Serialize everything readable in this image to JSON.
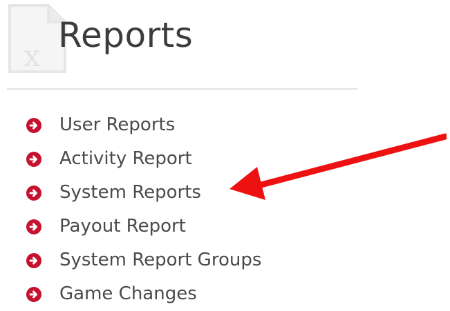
{
  "header": {
    "title": "Reports",
    "icon": "excel-document-icon"
  },
  "reports": {
    "items": [
      {
        "label": "User Reports",
        "icon": "circle-arrow-right-icon"
      },
      {
        "label": "Activity Report",
        "icon": "circle-arrow-right-icon"
      },
      {
        "label": "System Reports",
        "icon": "circle-arrow-right-icon"
      },
      {
        "label": "Payout Report",
        "icon": "circle-arrow-right-icon"
      },
      {
        "label": "System Report Groups",
        "icon": "circle-arrow-right-icon"
      },
      {
        "label": "Game Changes",
        "icon": "circle-arrow-right-icon"
      }
    ]
  },
  "annotation": {
    "arrow_color": "#ee1111",
    "points_to": "System Reports"
  },
  "colors": {
    "bullet": "#c4122f",
    "title_text": "#3c3c3c",
    "item_text": "#4a4a4a",
    "divider": "#e2e2e2"
  }
}
